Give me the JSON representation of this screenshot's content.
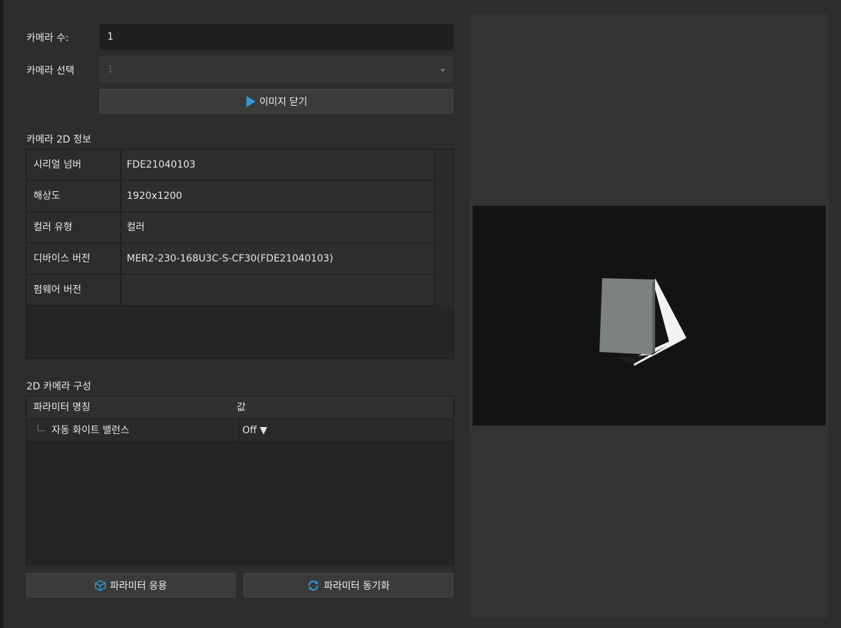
{
  "camera_count": {
    "label": "카메라 수:",
    "value": "1"
  },
  "camera_select": {
    "label": "카메라 선택",
    "value": "1"
  },
  "close_image_button": {
    "label": "이미지 닫기"
  },
  "camera_info": {
    "title": "카메라 2D 정보",
    "rows": [
      {
        "key": "시리얼 넘버",
        "value": "FDE21040103"
      },
      {
        "key": "해상도",
        "value": "1920x1200"
      },
      {
        "key": "컬러 유형",
        "value": "컬러"
      },
      {
        "key": "디바이스 버전",
        "value": "MER2-230-168U3C-S-CF30(FDE21040103)"
      },
      {
        "key": "펌웨어 버전",
        "value": ""
      }
    ]
  },
  "camera_config": {
    "title": "2D 카메라 구성",
    "header": {
      "name": "파라미터 명칭",
      "value": "값"
    },
    "rows": [
      {
        "name": "자동 화이트 밸런스",
        "value": "Off ▼"
      }
    ]
  },
  "buttons": {
    "apply": "파라미터 응용",
    "sync": "파라미터 동기화"
  },
  "colors": {
    "accent": "#2a9be0",
    "panel": "#2d2d2d"
  },
  "icons": {
    "play": "play-icon",
    "apply": "cube-icon",
    "sync": "refresh-icon"
  }
}
